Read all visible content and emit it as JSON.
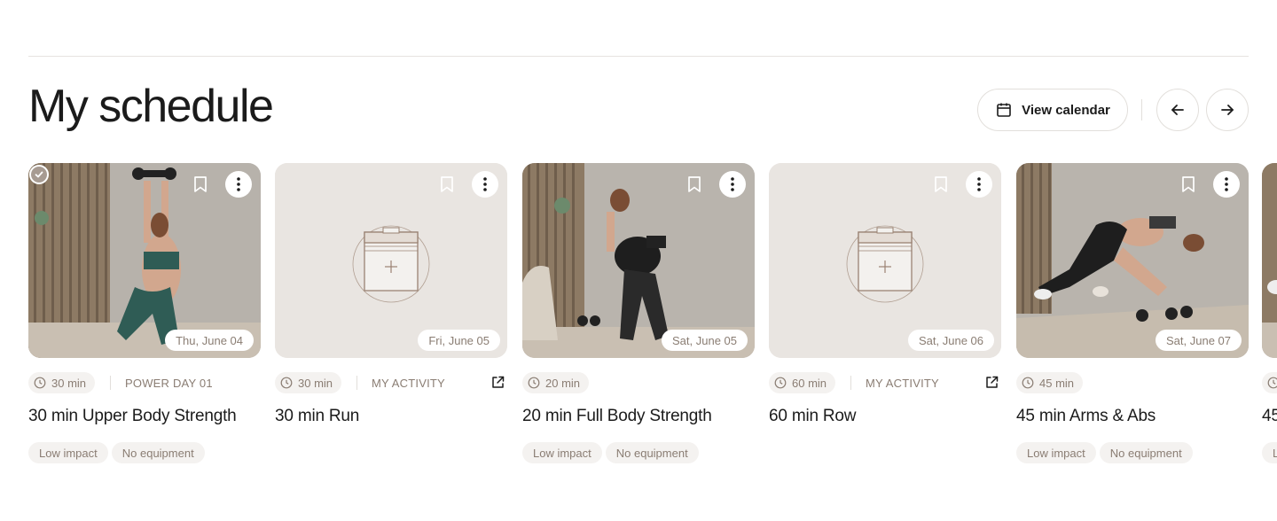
{
  "page": {
    "title": "My schedule"
  },
  "header": {
    "view_calendar": "View calendar"
  },
  "icons": {
    "calendar": "calendar-icon",
    "prev": "arrow-left-icon",
    "next": "arrow-right-icon",
    "bookmark": "bookmark-icon",
    "more": "more-vertical-icon",
    "clock": "clock-icon",
    "external": "external-link-icon",
    "check": "check-icon",
    "placeholder": "calendar-add-icon"
  },
  "colors": {
    "accent_muted": "#8a7d73",
    "card_bg": "#e9e5e1",
    "pill_bg": "#f4f2f0"
  },
  "cards": [
    {
      "date": "Thu, June 04",
      "duration": "30 min",
      "category": "POWER DAY 01",
      "title": "30 min Upper Body Strength",
      "tags": [
        "Low impact",
        "No equipment"
      ],
      "completed": true
    },
    {
      "date": "Fri, June 05",
      "duration": "30 min",
      "category": "MY ACTIVITY",
      "title": "30 min Run",
      "tags": []
    },
    {
      "date": "Sat, June 05",
      "duration": "20 min",
      "category": "",
      "title": "20 min Full Body Strength",
      "tags": [
        "Low impact",
        "No equipment"
      ]
    },
    {
      "date": "Sat, June 06",
      "duration": "60 min",
      "category": "MY ACTIVITY",
      "title": "60 min Row",
      "tags": []
    },
    {
      "date": "Sat, June 07",
      "duration": "45 min",
      "category": "",
      "title": "45 min Arms & Abs",
      "tags": [
        "Low impact",
        "No equipment"
      ]
    },
    {
      "date": "",
      "duration": "",
      "category": "",
      "title": "45",
      "tags": [
        "L"
      ]
    }
  ]
}
